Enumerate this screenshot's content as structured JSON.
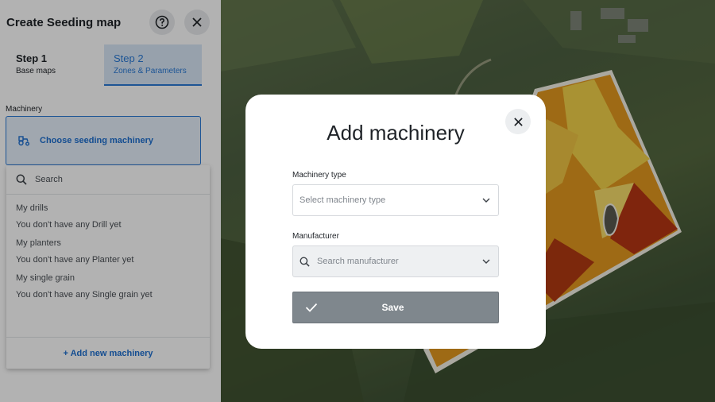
{
  "panel": {
    "title": "Create Seeding map",
    "help_icon": "help-circle-icon",
    "close_icon": "close-icon",
    "steps": [
      {
        "num": "Step 1",
        "sub": "Base maps"
      },
      {
        "num": "Step 2",
        "sub": "Zones & Parameters"
      }
    ],
    "section_label": "Machinery",
    "machine_button_label": "Choose seeding machinery",
    "machine_icon": "tractor-icon"
  },
  "dropdown": {
    "search_placeholder": "Search",
    "groups": [
      {
        "title": "My drills",
        "empty": "You don't have any Drill yet"
      },
      {
        "title": "My planters",
        "empty": "You don't have any Planter yet"
      },
      {
        "title": "My single grain",
        "empty": "You don't have any Single grain yet"
      }
    ],
    "add_label": "+ Add new machinery"
  },
  "modal": {
    "title": "Add machinery",
    "type_label": "Machinery type",
    "type_placeholder": "Select machinery type",
    "manufacturer_label": "Manufacturer",
    "manufacturer_placeholder": "Search manufacturer",
    "save_label": "Save"
  },
  "colors": {
    "accent": "#2a7ad6",
    "zone_yellow": "#f2d04a",
    "zone_orange": "#e39a1c",
    "zone_dark": "#8a1a0e"
  }
}
